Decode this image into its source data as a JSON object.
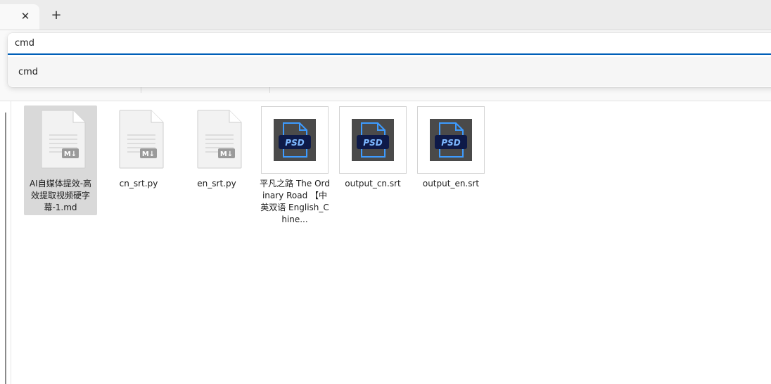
{
  "tabs": {
    "close_icon": "✕",
    "new_tab_icon": "+"
  },
  "address": {
    "value": "cmd"
  },
  "suggestions": [
    {
      "label": "cmd"
    }
  ],
  "files": [
    {
      "name": "AI自媒体提效-高效提取视频硬字幕-1.md",
      "type": "markdown",
      "selected": true
    },
    {
      "name": "cn_srt.py",
      "type": "python",
      "selected": false
    },
    {
      "name": "en_srt.py",
      "type": "python",
      "selected": false
    },
    {
      "name": "平凡之路 The Ordinary Road 【中英双语 English_Chine...",
      "type": "psd",
      "selected": false
    },
    {
      "name": "output_cn.srt",
      "type": "psd",
      "selected": false
    },
    {
      "name": "output_en.srt",
      "type": "psd",
      "selected": false
    }
  ],
  "icons": {
    "doc_badge": "M↓",
    "psd_badge": "PSD"
  },
  "colors": {
    "accent": "#005fb8",
    "psd_bg": "#4a4a4a",
    "psd_badge": "#0e1a48",
    "psd_accent": "#3d9bff",
    "selection": "#d9d9d9"
  }
}
